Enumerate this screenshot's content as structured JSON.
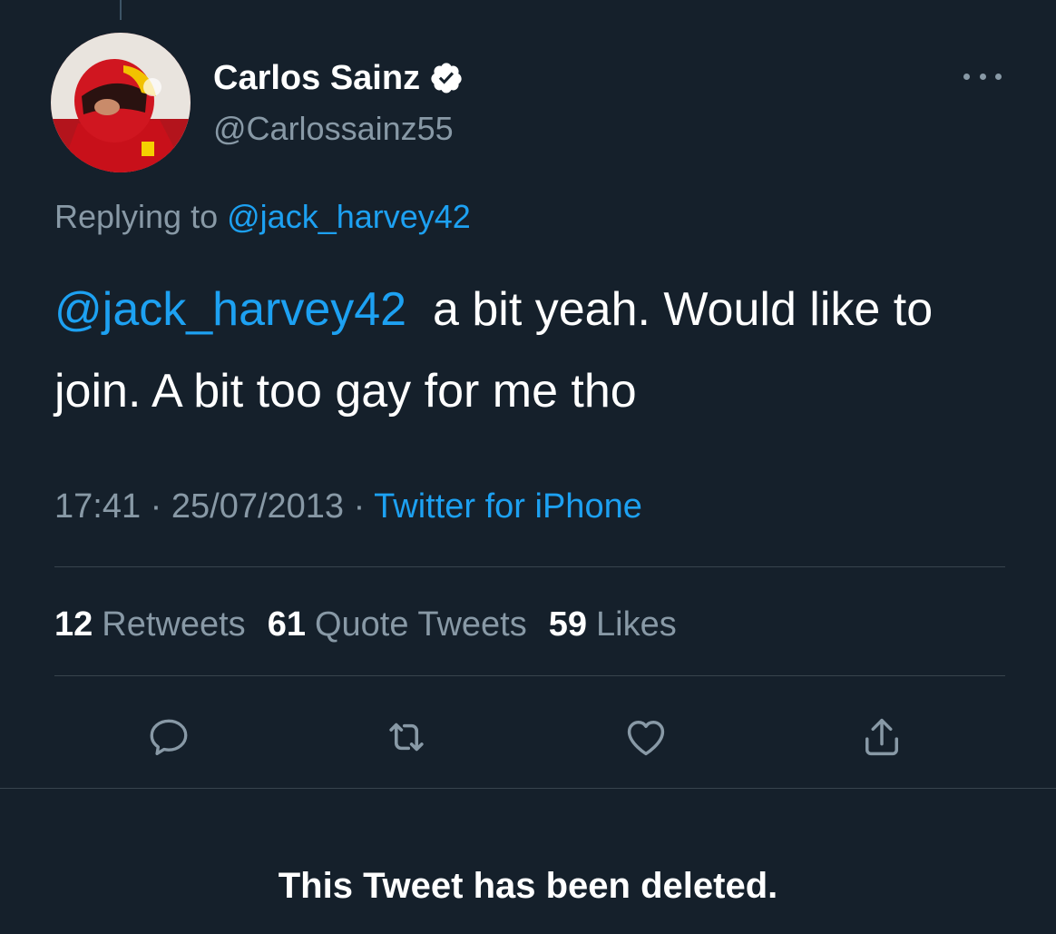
{
  "author": {
    "display_name": "Carlos Sainz",
    "handle": "@Carlossainz55",
    "verified": true
  },
  "reply": {
    "prefix": "Replying to",
    "to_handle": "@jack_harvey42"
  },
  "tweet": {
    "mention": "@jack_harvey42",
    "text": "a bit yeah. Would like to join. A bit too gay for me tho"
  },
  "meta": {
    "time": "17:41",
    "date": "25/07/2013",
    "separator": "·",
    "source": "Twitter for iPhone"
  },
  "stats": {
    "retweets_count": "12",
    "retweets_label": "Retweets",
    "quotes_count": "61",
    "quotes_label": "Quote Tweets",
    "likes_count": "59",
    "likes_label": "Likes"
  },
  "actions": {
    "reply_icon": "reply-icon",
    "retweet_icon": "retweet-icon",
    "like_icon": "heart-icon",
    "share_icon": "share-icon"
  },
  "deleted_notice": "This Tweet has been deleted.",
  "colors": {
    "background": "#15202b",
    "link": "#1da1f2",
    "secondary_text": "#8899a6",
    "divider": "#38444d"
  }
}
